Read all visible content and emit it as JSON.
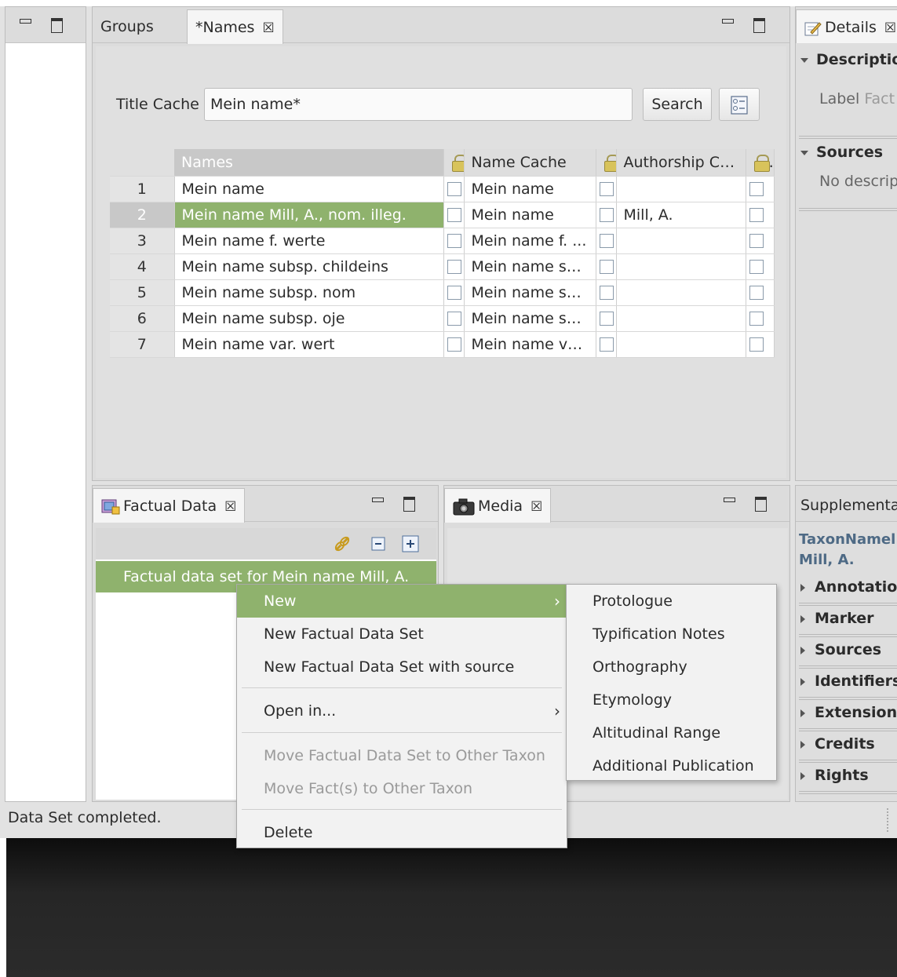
{
  "left_pane": {},
  "names_editor": {
    "tabs": [
      {
        "label": "Groups"
      },
      {
        "label": "*Names",
        "close": "☒"
      }
    ],
    "search": {
      "label": "Title Cache",
      "value": "Mein name*",
      "button": "Search"
    },
    "table": {
      "headers": {
        "names": "Names",
        "name_cache": "Name Cache",
        "authorship": "Authorship Ca..."
      },
      "rows": [
        {
          "num": "1",
          "name": "Mein name",
          "cache": "Mein name",
          "authorship": ""
        },
        {
          "num": "2",
          "name": "Mein name Mill, A., nom. illeg.",
          "cache": "Mein name",
          "authorship": "Mill, A."
        },
        {
          "num": "3",
          "name": "Mein name f. werte",
          "cache": "Mein name f. ...",
          "authorship": ""
        },
        {
          "num": "4",
          "name": "Mein name subsp. childeins",
          "cache": "Mein name su...",
          "authorship": ""
        },
        {
          "num": "5",
          "name": "Mein name subsp. nom",
          "cache": "Mein name su...",
          "authorship": ""
        },
        {
          "num": "6",
          "name": "Mein name subsp. oje",
          "cache": "Mein name su...",
          "authorship": ""
        },
        {
          "num": "7",
          "name": "Mein name var. wert",
          "cache": "Mein name va...",
          "authorship": ""
        }
      ],
      "selected_row": 2
    }
  },
  "details": {
    "tab": "Details",
    "close": "☒",
    "description_section": "Descriptio",
    "label_text": "Label",
    "label_value": "Fact",
    "sources_section": "Sources",
    "no_description": "No descrip"
  },
  "factual_data": {
    "tab": "Factual Data",
    "close": "☒",
    "item": "Factual data set for Mein name Mill, A."
  },
  "media": {
    "tab": "Media",
    "close": "☒"
  },
  "supplemental": {
    "tab": "Supplementa",
    "entity_line1": "TaxonNamel",
    "entity_line2": "Mill, A.",
    "sections": [
      "Annotatio",
      "Marker",
      "Sources",
      "Identifiers",
      "Extension",
      "Credits",
      "Rights"
    ]
  },
  "status_bar": {
    "text": "Data Set completed."
  },
  "context_menu": {
    "items": [
      {
        "label": "New",
        "submenu": true,
        "highlighted": true
      },
      {
        "label": "New Factual Data Set"
      },
      {
        "label": "New Factual Data Set with source"
      },
      {
        "label": "Open in...",
        "submenu": true
      },
      {
        "label": "Move Factual Data Set to Other Taxon",
        "disabled": true
      },
      {
        "label": "Move Fact(s) to Other Taxon",
        "disabled": true
      },
      {
        "label": "Delete"
      }
    ],
    "arrow": "›"
  },
  "submenu": {
    "items": [
      "Protologue",
      "Typification Notes",
      "Orthography",
      "Etymology",
      "Altitudinal Range",
      "Additional Publication"
    ]
  },
  "colors": {
    "highlight": "#8fb26d",
    "panel": "#dcdcdc",
    "desktop": "#2b2b2b"
  }
}
